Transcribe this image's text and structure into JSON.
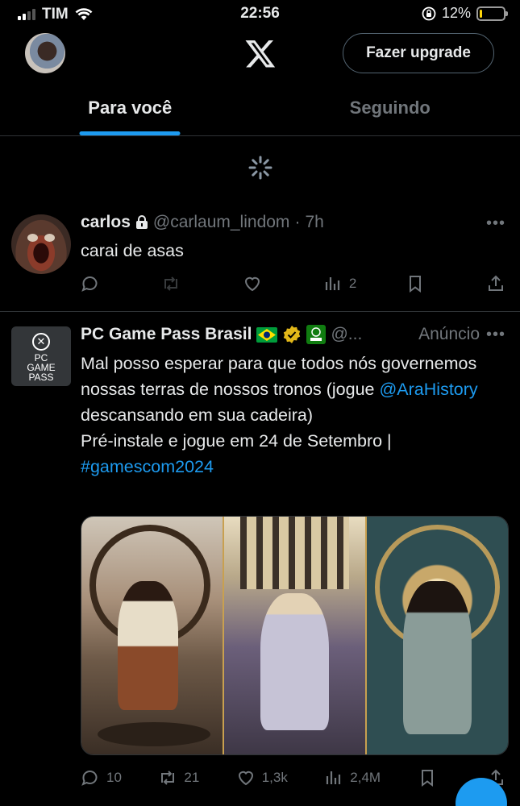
{
  "status_bar": {
    "carrier": "TIM",
    "time": "22:56",
    "battery": "12%",
    "battery_level": 0.12
  },
  "header": {
    "upgrade_label": "Fazer upgrade",
    "logo": "x-logo"
  },
  "tabs": [
    {
      "label": "Para você",
      "active": true
    },
    {
      "label": "Seguindo",
      "active": false
    }
  ],
  "tweets": [
    {
      "name": "carlos",
      "locked": true,
      "handle": "@carlaum_lindom",
      "time": "7h",
      "text": "carai de asas",
      "views": "2"
    },
    {
      "name": "PC Game Pass Brasil",
      "avatar_text": [
        "PC",
        "GAME",
        "PASS"
      ],
      "handle": "@...",
      "ad_label": "Anúncio",
      "text_1": "Mal posso esperar para que todos nós governemos nossas terras de nossos tronos (jogue ",
      "mention": "@AraHistory",
      "text_2": " descansando em sua cadeira)",
      "text_3": "Pré-instale e jogue em 24 de Setembro |",
      "hashtag": "#gamescom2024",
      "replies": "10",
      "reposts": "21",
      "likes": "1,3k",
      "views": "2,4M"
    }
  ],
  "colors": {
    "accent": "#1d9bf0",
    "muted": "#71767b",
    "border": "#2f3336"
  }
}
